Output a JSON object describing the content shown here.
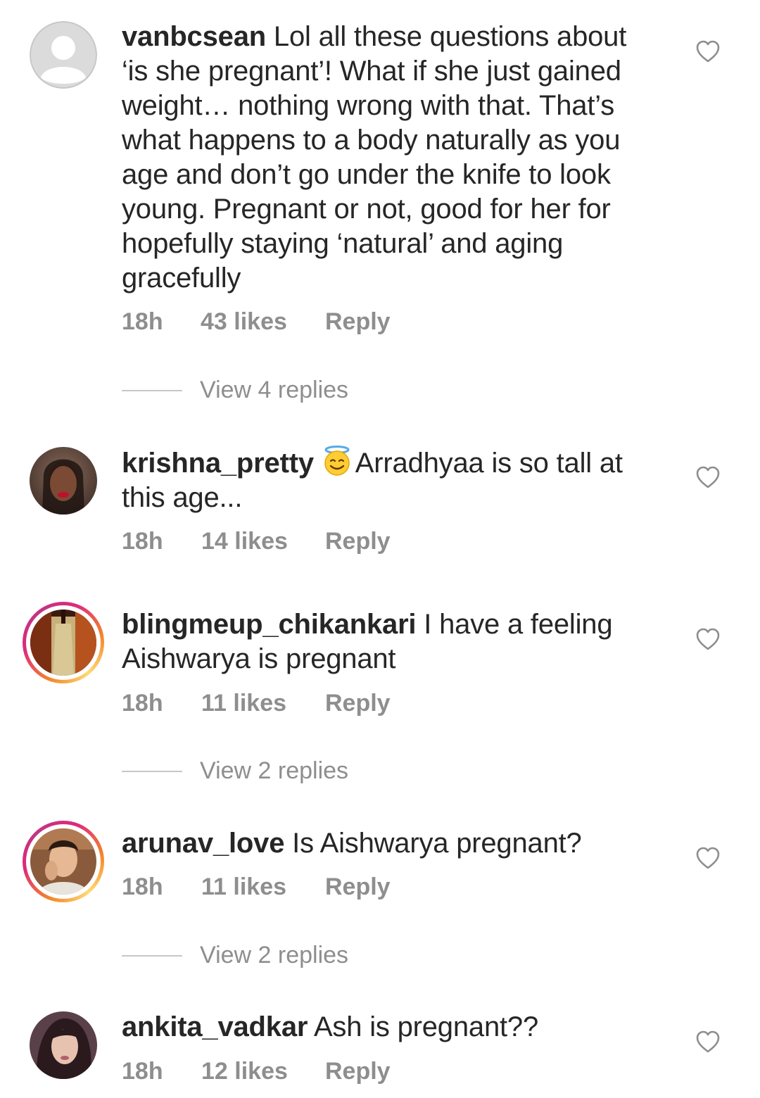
{
  "comments": [
    {
      "username": "vanbcsean",
      "text": " Lol all these questions about ‘is she pregnant’! What if she just gained weight… nothing wrong with that. That’s what happens to a body naturally as you age and don’t go under the knife to look young. Pregnant or not, good for her for hopefully staying ‘natural’ and aging gracefully",
      "time": "18h",
      "likes": "43 likes",
      "reply": "Reply",
      "view_replies": "View 4 replies"
    },
    {
      "username": "krishna_pretty",
      "emoji": "smiling-face-with-halo-emoji",
      "text": "Arradhyaa is so tall at this age...",
      "time": "18h",
      "likes": "14 likes",
      "reply": "Reply"
    },
    {
      "username": "blingmeup_chikankari",
      "text": " I have a feeling Aishwarya is pregnant",
      "time": "18h",
      "likes": "11 likes",
      "reply": "Reply",
      "view_replies": "View 2 replies"
    },
    {
      "username": "arunav_love",
      "text": " Is Aishwarya pregnant?",
      "time": "18h",
      "likes": "11 likes",
      "reply": "Reply",
      "view_replies": "View 2 replies"
    },
    {
      "username": "ankita_vadkar",
      "text": " Ash is pregnant??",
      "time": "18h",
      "likes": "12 likes",
      "reply": "Reply"
    }
  ],
  "icons": {
    "like": "heart-outline-icon",
    "default_avatar": "default-avatar-icon"
  },
  "colors": {
    "text": "#262626",
    "meta": "#8e8e8e",
    "story_ring_start": "#f58529",
    "story_ring_end": "#dd2a7b"
  }
}
